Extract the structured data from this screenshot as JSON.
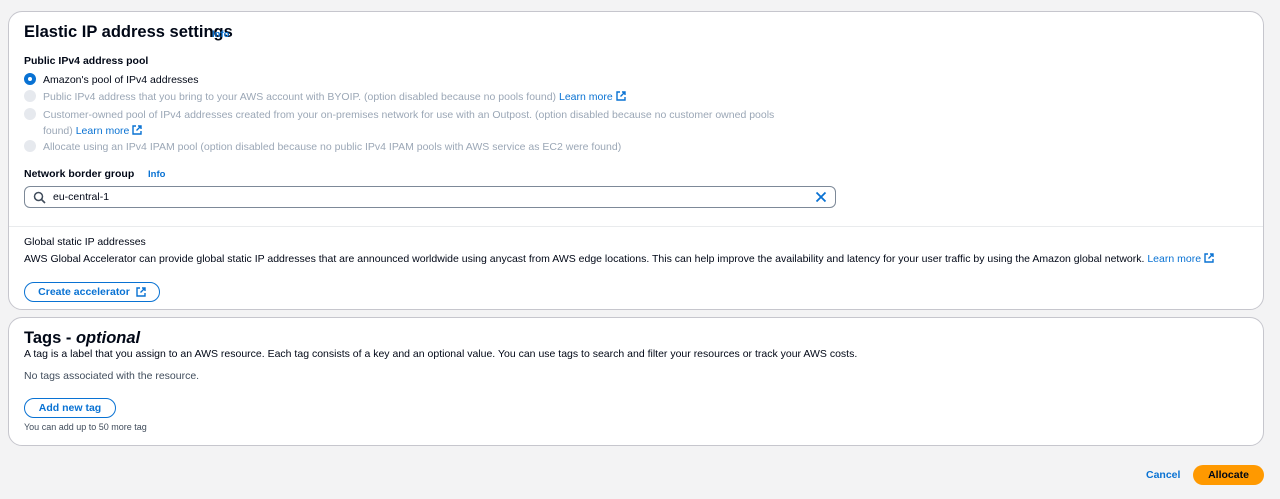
{
  "eip": {
    "title": "Elastic IP address settings",
    "info": "Info",
    "pool_label": "Public IPv4 address pool",
    "options": [
      {
        "label": "Amazon's pool of IPv4 addresses",
        "checked": true,
        "disabled": false
      },
      {
        "label": "Public IPv4 address that you bring to your AWS account with BYOIP. (option disabled because no pools found)",
        "link": "Learn more",
        "checked": false,
        "disabled": true
      },
      {
        "label_line1": "Customer-owned pool of IPv4 addresses created from your on-premises network for use with an Outpost. (option disabled because no customer owned pools",
        "label_line2": "found)",
        "link": "Learn more",
        "checked": false,
        "disabled": true
      },
      {
        "label": "Allocate using an IPv4 IPAM pool (option disabled because no public IPv4 IPAM pools with AWS service as EC2 were found)",
        "checked": false,
        "disabled": true
      }
    ],
    "nbg_label": "Network border group",
    "nbg_info": "Info",
    "nbg_value": "eu-central-1",
    "global_title": "Global static IP addresses",
    "global_desc": "AWS Global Accelerator can provide global static IP addresses that are announced worldwide using anycast from AWS edge locations. This can help improve the availability and latency for your user traffic by using the Amazon global network.",
    "global_link_1": "Learn",
    "global_link_2": "more",
    "create_accelerator": "Create accelerator"
  },
  "tags": {
    "title": "Tags - ",
    "title_optional": "optional",
    "desc": "A tag is a label that you assign to an AWS resource. Each tag consists of a key and an optional value. You can use tags to search and filter your resources or track your AWS costs.",
    "empty": "No tags associated with the resource.",
    "add_button": "Add new tag",
    "limit": "You can add up to 50 more tag"
  },
  "footer": {
    "cancel": "Cancel",
    "allocate": "Allocate"
  },
  "colors": {
    "accent": "#0972d3",
    "primary_button": "#ff9900",
    "disabled_text": "#9ba7b6"
  }
}
